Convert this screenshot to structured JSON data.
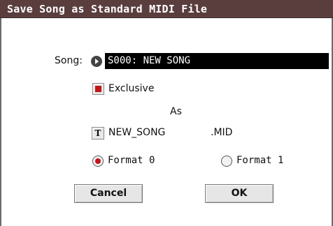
{
  "dialog": {
    "title": "Save Song as Standard MIDI File",
    "song": {
      "label": "Song:",
      "value": "S000: NEW SONG",
      "selector_icon": "right-arrow-circle-icon"
    },
    "exclusive": {
      "label": "Exclusive",
      "checked": true
    },
    "as_label": "As",
    "file": {
      "text_edit_icon": "T",
      "name": "NEW_SONG",
      "extension": ".MID"
    },
    "formats": [
      {
        "label": "Format 0",
        "selected": true
      },
      {
        "label": "Format 1",
        "selected": false
      }
    ],
    "buttons": {
      "cancel": "Cancel",
      "ok": "OK"
    },
    "colors": {
      "titlebar": "#5a3e3e",
      "accent_red": "#c2141a",
      "field_bg": "#000000"
    }
  }
}
